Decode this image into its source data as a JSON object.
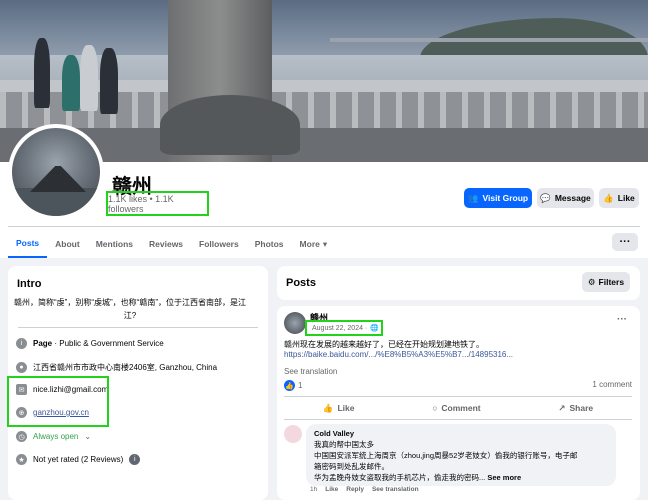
{
  "page": {
    "name": "赣州",
    "stats": "1.1K likes • 1.1K followers"
  },
  "buttons": {
    "visit_group": "Visit Group",
    "message": "Message",
    "like": "Like"
  },
  "tabs": [
    {
      "label": "Posts"
    },
    {
      "label": "About"
    },
    {
      "label": "Mentions"
    },
    {
      "label": "Reviews"
    },
    {
      "label": "Followers"
    },
    {
      "label": "Photos"
    },
    {
      "label": "More"
    }
  ],
  "intro": {
    "title": "Intro",
    "description": "赣州，简称“虔”，别称“虔城”，也称“赣南”，位于江西省南部，是江",
    "description_end": "江?",
    "page_type_label": "Page",
    "page_type": " · Public & Government Service",
    "address": "江西省赣州市市政中心南楼2406室, Ganzhou, China",
    "email": "nice.lizhi@gmail.com",
    "website": "ganzhou.gov.cn",
    "hours": "Always open",
    "rating": "Not yet rated (2 Reviews)"
  },
  "posts": {
    "title": "Posts",
    "filters": "Filters",
    "post": {
      "author": "赣州",
      "date": "August 22, 2024 ·",
      "text": "赣州现在发展的越来越好了，已经在开始规划建地铁了。",
      "link": "https://baike.baidu.com/.../%E8%B5%A3%E5%B7.../14895316...",
      "see_translation": "See translation",
      "likes": "1",
      "comments_count": "1 comment",
      "action_like": "Like",
      "action_comment": "Comment",
      "action_share": "Share",
      "comment": {
        "author": "Cold Valley",
        "line1": "我真的帮中国太多",
        "line2": "中国国安派军统上海周京（zhou,jing周暴52岁老妓女）偷我的银行账号，电子邮",
        "line3": "箱密码到处乱发邮件。",
        "line4": "华为孟晚舟妓女盗取我的手机芯片，偷走我的密码...",
        "see_more": "See more",
        "foot_time": "1h",
        "foot_like": "Like",
        "foot_reply": "Reply",
        "foot_trans": "See translation"
      }
    }
  },
  "colors": {
    "accent": "#0866ff",
    "highlight": "#22d21b",
    "text_secondary": "#65676b"
  }
}
